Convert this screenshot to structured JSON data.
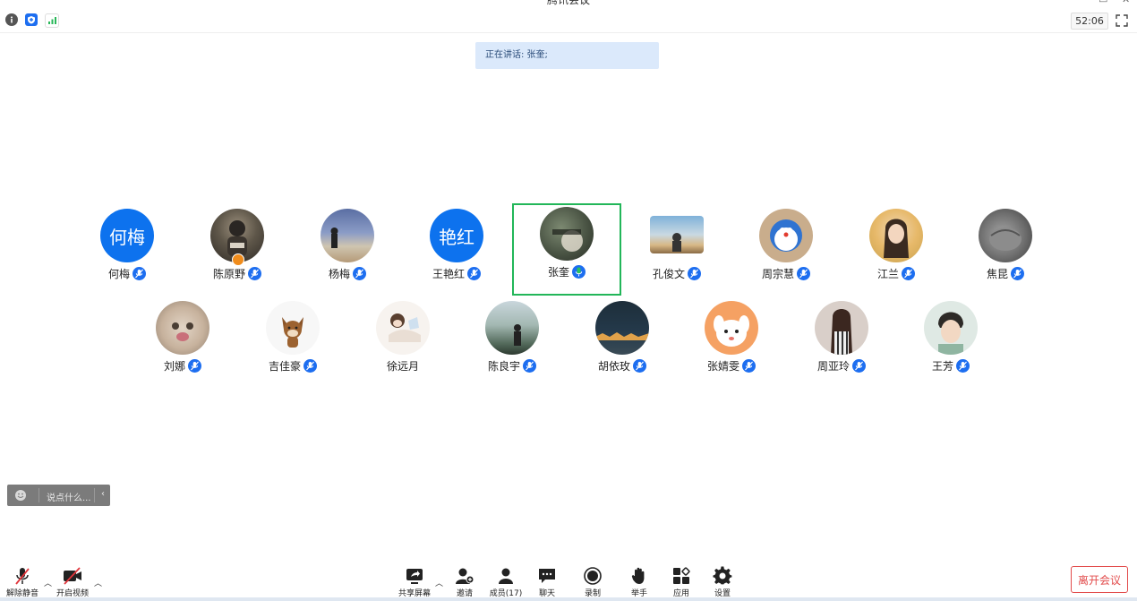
{
  "window": {
    "title": "腾讯会议"
  },
  "topbar": {
    "timer": "52:06"
  },
  "speaking_banner": {
    "text": "正在讲话: 张奎;"
  },
  "participants": [
    {
      "name": "何梅",
      "avatar_text": "何梅",
      "mic": "muted"
    },
    {
      "name": "陈原野",
      "avatar_text": "",
      "mic": "muted",
      "host": true
    },
    {
      "name": "杨梅",
      "avatar_text": "",
      "mic": "muted"
    },
    {
      "name": "王艳红",
      "avatar_text": "艳红",
      "mic": "muted"
    },
    {
      "name": "张奎",
      "avatar_text": "",
      "mic": "speaking",
      "active": true
    },
    {
      "name": "孔俊文",
      "avatar_text": "",
      "mic": "muted"
    },
    {
      "name": "周宗慧",
      "avatar_text": "",
      "mic": "muted"
    },
    {
      "name": "江兰",
      "avatar_text": "",
      "mic": "muted"
    },
    {
      "name": "焦昆",
      "avatar_text": "",
      "mic": "muted"
    },
    {
      "name": "刘娜",
      "avatar_text": "",
      "mic": "muted"
    },
    {
      "name": "吉佳豪",
      "avatar_text": "",
      "mic": "muted"
    },
    {
      "name": "徐远月",
      "avatar_text": "",
      "mic": "none"
    },
    {
      "name": "陈良宇",
      "avatar_text": "",
      "mic": "muted"
    },
    {
      "name": "胡依玫",
      "avatar_text": "",
      "mic": "muted"
    },
    {
      "name": "张婧雯",
      "avatar_text": "",
      "mic": "muted"
    },
    {
      "name": "周亚玲",
      "avatar_text": "",
      "mic": "muted"
    },
    {
      "name": "王芳",
      "avatar_text": "",
      "mic": "muted"
    }
  ],
  "chat_input": {
    "placeholder": "说点什么..."
  },
  "toolbar": {
    "unmute": "解除静音",
    "start_video": "开启视频",
    "share_screen": "共享屏幕",
    "invite": "邀请",
    "members": "成员(17)",
    "chat": "聊天",
    "record": "录制",
    "raise_hand": "举手",
    "apps": "应用",
    "settings": "设置",
    "leave": "离开会议"
  },
  "colors": {
    "accent": "#0d72ee",
    "active_border": "#22b659",
    "leave": "#e24b4b"
  }
}
